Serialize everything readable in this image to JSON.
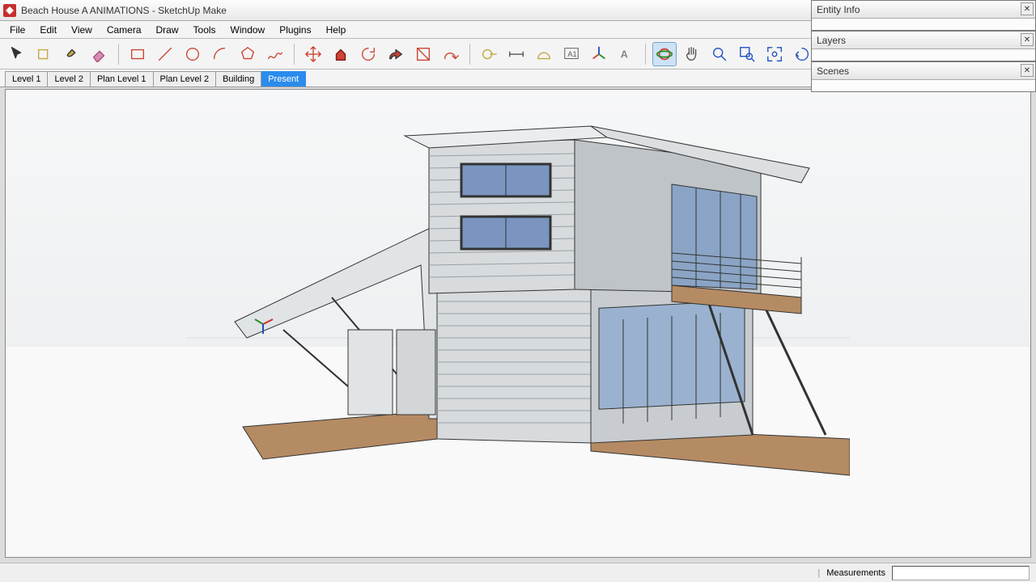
{
  "window": {
    "title": "Beach House A ANIMATIONS - SketchUp Make"
  },
  "menus": [
    "File",
    "Edit",
    "View",
    "Camera",
    "Draw",
    "Tools",
    "Window",
    "Plugins",
    "Help"
  ],
  "toolbar": [
    {
      "name": "select",
      "icon": "cursor"
    },
    {
      "name": "make-component",
      "icon": "component"
    },
    {
      "name": "paint",
      "icon": "paint"
    },
    {
      "name": "eraser",
      "icon": "eraser"
    },
    {
      "sep": true
    },
    {
      "name": "rectangle",
      "icon": "rect"
    },
    {
      "name": "line",
      "icon": "line"
    },
    {
      "name": "circle",
      "icon": "circle"
    },
    {
      "name": "arc",
      "icon": "arc"
    },
    {
      "name": "polygon",
      "icon": "polygon"
    },
    {
      "name": "freehand",
      "icon": "freehand"
    },
    {
      "sep": true
    },
    {
      "name": "move",
      "icon": "move"
    },
    {
      "name": "pushpull",
      "icon": "pushpull"
    },
    {
      "name": "rotate",
      "icon": "rotate"
    },
    {
      "name": "followme",
      "icon": "followme"
    },
    {
      "name": "scale",
      "icon": "scale"
    },
    {
      "name": "offset",
      "icon": "offset"
    },
    {
      "sep": true
    },
    {
      "name": "tape",
      "icon": "tape"
    },
    {
      "name": "dimension",
      "icon": "dimension"
    },
    {
      "name": "protractor",
      "icon": "protractor"
    },
    {
      "name": "text",
      "icon": "text"
    },
    {
      "name": "axes",
      "icon": "axes"
    },
    {
      "name": "3dtext",
      "icon": "3dtext"
    },
    {
      "sep": true
    },
    {
      "name": "orbit",
      "icon": "orbit",
      "active": true
    },
    {
      "name": "pan",
      "icon": "pan"
    },
    {
      "name": "zoom",
      "icon": "zoom"
    },
    {
      "name": "zoom-window",
      "icon": "zoomwin"
    },
    {
      "name": "zoom-extents",
      "icon": "zoomext"
    },
    {
      "name": "previous",
      "icon": "prev"
    }
  ],
  "scene_tabs": [
    {
      "label": "Level 1",
      "active": false
    },
    {
      "label": "Level 2",
      "active": false
    },
    {
      "label": "Plan Level 1",
      "active": false
    },
    {
      "label": "Plan Level 2",
      "active": false
    },
    {
      "label": "Building",
      "active": false
    },
    {
      "label": "Present",
      "active": true
    }
  ],
  "status": {
    "measurements_label": "Measurements"
  },
  "panels": [
    {
      "title": "Entity Info"
    },
    {
      "title": "Layers"
    },
    {
      "title": "Scenes"
    }
  ]
}
